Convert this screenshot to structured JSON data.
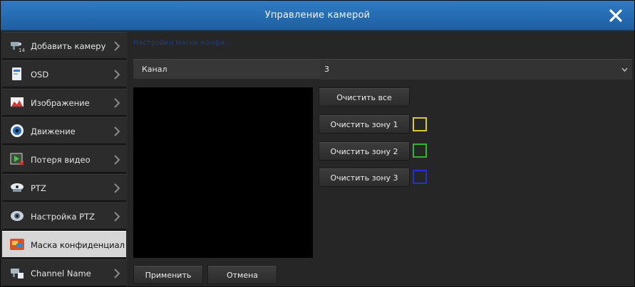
{
  "window": {
    "title": "Управление камерой"
  },
  "sidebar": {
    "items": [
      {
        "label": "Добавить камеру",
        "icon": "camera-add-icon"
      },
      {
        "label": "OSD",
        "icon": "osd-icon"
      },
      {
        "label": "Изображение",
        "icon": "image-chart-icon"
      },
      {
        "label": "Движение",
        "icon": "motion-icon"
      },
      {
        "label": "Потеря видео",
        "icon": "video-loss-icon"
      },
      {
        "label": "PTZ",
        "icon": "ptz-camera-icon"
      },
      {
        "label": "Настройка PTZ",
        "icon": "ptz-settings-icon"
      },
      {
        "label": "Маска конфиденциальности",
        "icon": "privacy-mask-icon",
        "active": true
      },
      {
        "label": "Channel Name",
        "icon": "channel-name-icon"
      }
    ]
  },
  "main": {
    "section_title": "Настройки маски конфи...",
    "channel": {
      "label": "Канал",
      "value": "3"
    },
    "buttons": {
      "clear_all": "Очистить все",
      "clear_zone_1": "Очистить зону 1",
      "clear_zone_2": "Очистить зону 2",
      "clear_zone_3": "Очистить зону 3",
      "apply": "Применить",
      "cancel": "Отмена"
    },
    "zone_colors": {
      "zone1": "#d9c93a",
      "zone2": "#2fb53a",
      "zone3": "#1f33c8"
    }
  },
  "colors": {
    "title_bar": "#2a6fb4",
    "active_item": "#d6d6d6",
    "background": "#262626"
  }
}
